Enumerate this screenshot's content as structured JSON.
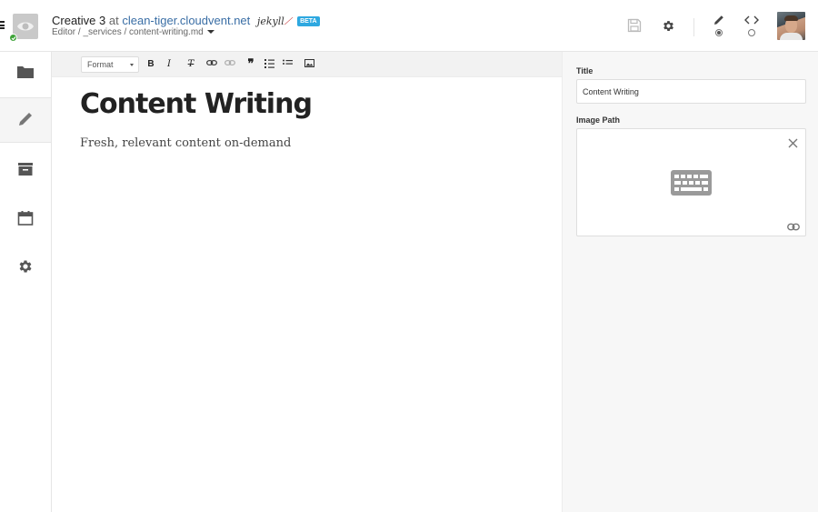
{
  "header": {
    "site_name": "Creative 3",
    "at_text": "at",
    "domain": "clean-tiger.cloudvent.net",
    "ssg_name": "jekyll",
    "beta_badge": "BETA",
    "breadcrumb": "Editor / _services / content-writing.md",
    "status": "published"
  },
  "toolbar": {
    "format_label": "Format",
    "bold_label": "B",
    "italic_label": "I",
    "clear_label": "T"
  },
  "document": {
    "title": "Content Writing",
    "subtitle": "Fresh, relevant content on-demand"
  },
  "panel": {
    "title_label": "Title",
    "title_value": "Content Writing",
    "image_label": "Image Path"
  },
  "colors": {
    "accent": "#3a6ea5",
    "beta": "#2ea8e0",
    "status_ok": "#3fa33a"
  }
}
